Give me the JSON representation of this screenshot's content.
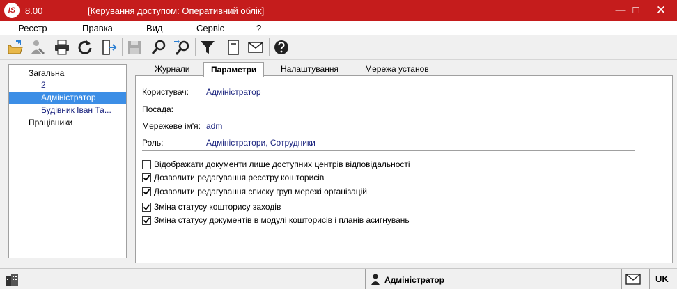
{
  "window": {
    "logo_text": "IS",
    "version": "8.00",
    "title": "[Керування доступом:  Оперативний облік]"
  },
  "menu": [
    "Реєстр",
    "Правка",
    "Вид",
    "Сервіс",
    "?"
  ],
  "toolbar_icons": [
    "open-folder-icon",
    "edit-user-icon",
    "print-icon",
    "refresh-icon",
    "exit-icon",
    "save-icon",
    "search-icon",
    "search-next-icon",
    "filter-icon",
    "notes-icon",
    "mail-icon",
    "help-icon"
  ],
  "tree": {
    "items": [
      {
        "label": "Загальна",
        "level": 0
      },
      {
        "label": "2",
        "level": 1
      },
      {
        "label": "Адміністратор",
        "level": 1,
        "selected": true
      },
      {
        "label": "Будівник Іван Та...",
        "level": 1
      },
      {
        "label": "Працівники",
        "level": 0
      }
    ]
  },
  "tabs": [
    {
      "label": "Журнали"
    },
    {
      "label": "Параметри",
      "active": true
    },
    {
      "label": "Налаштування"
    },
    {
      "label": "Мережа установ"
    }
  ],
  "fields": {
    "user_label": "Користувач:",
    "user_value": "Адміністратор",
    "position_label": "Посада:",
    "network_label": "Мережеве ім'я:",
    "network_value": "adm",
    "role_label": "Роль:",
    "role_value": "Адміністратори, Сотрудники"
  },
  "checkboxes": [
    {
      "label": "Відображати документи лише доступних центрів відповідальності",
      "checked": false
    },
    {
      "label": "Дозволити редагування реєстру кошторисів",
      "checked": true
    },
    {
      "label": "Дозволити редагування списку груп мережі організацій",
      "checked": true
    },
    {
      "label": "Зміна статусу кошторису заходів",
      "checked": true
    },
    {
      "label": "Зміна статусу документів в модулі кошторисів і планів асигнувань",
      "checked": true
    }
  ],
  "statusbar": {
    "user": "Адміністратор",
    "lang": "UK"
  },
  "colors": {
    "titlebar": "#c51c1c",
    "selection": "#3c8ee6",
    "value_text": "#1a237e"
  }
}
